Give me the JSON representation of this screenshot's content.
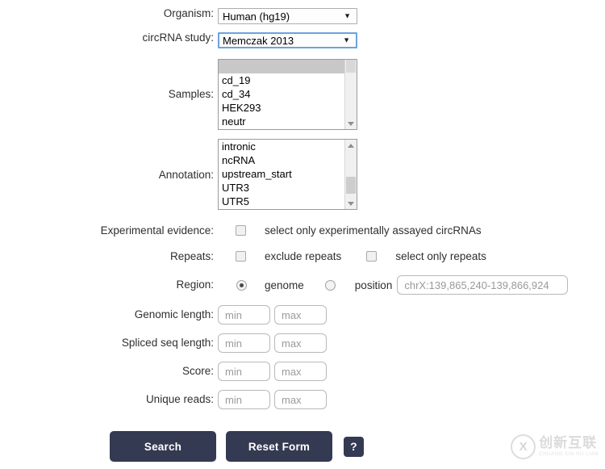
{
  "form": {
    "organism": {
      "label": "Organism:",
      "value": "Human (hg19)",
      "arrow_icon": "chevron-down-icon",
      "focused": false
    },
    "study": {
      "label": "circRNA study:",
      "value": "Memczak 2013",
      "arrow_icon": "chevron-down-icon",
      "focused": true
    },
    "samples": {
      "label": "Samples:",
      "options": [
        "",
        "cd_19",
        "cd_34",
        "HEK293",
        "neutr"
      ],
      "selected_index": 0
    },
    "annotation": {
      "label": "Annotation:",
      "options": [
        "intronic",
        "ncRNA",
        "upstream_start",
        "UTR3",
        "UTR5"
      ],
      "selected_index": -1
    },
    "experimental_evidence": {
      "label": "Experimental evidence:",
      "checkbox_label": "select only experimentally assayed circRNAs",
      "checked": false
    },
    "repeats": {
      "label": "Repeats:",
      "exclude_label": "exclude repeats",
      "exclude_checked": false,
      "only_label": "select only repeats",
      "only_checked": false
    },
    "region": {
      "label": "Region:",
      "genome_label": "genome",
      "genome_selected": true,
      "position_label": "position",
      "position_selected": false,
      "position_placeholder": "chrX:139,865,240-139,866,924",
      "position_value": ""
    },
    "genomic_length": {
      "label": "Genomic length:",
      "min_placeholder": "min",
      "max_placeholder": "max",
      "min_value": "",
      "max_value": ""
    },
    "spliced_seq_length": {
      "label": "Spliced seq length:",
      "min_placeholder": "min",
      "max_placeholder": "max",
      "min_value": "",
      "max_value": ""
    },
    "score": {
      "label": "Score:",
      "min_placeholder": "min",
      "max_placeholder": "max",
      "min_value": "",
      "max_value": ""
    },
    "unique_reads": {
      "label": "Unique reads:",
      "min_placeholder": "min",
      "max_placeholder": "max",
      "min_value": "",
      "max_value": ""
    },
    "actions": {
      "search_label": "Search",
      "reset_label": "Reset Form",
      "help_label": "?",
      "button_color": "#343a51"
    }
  },
  "watermark": {
    "mark": "X",
    "cn": "创新互联",
    "en": "CHUANG XIN HU LIAN"
  }
}
